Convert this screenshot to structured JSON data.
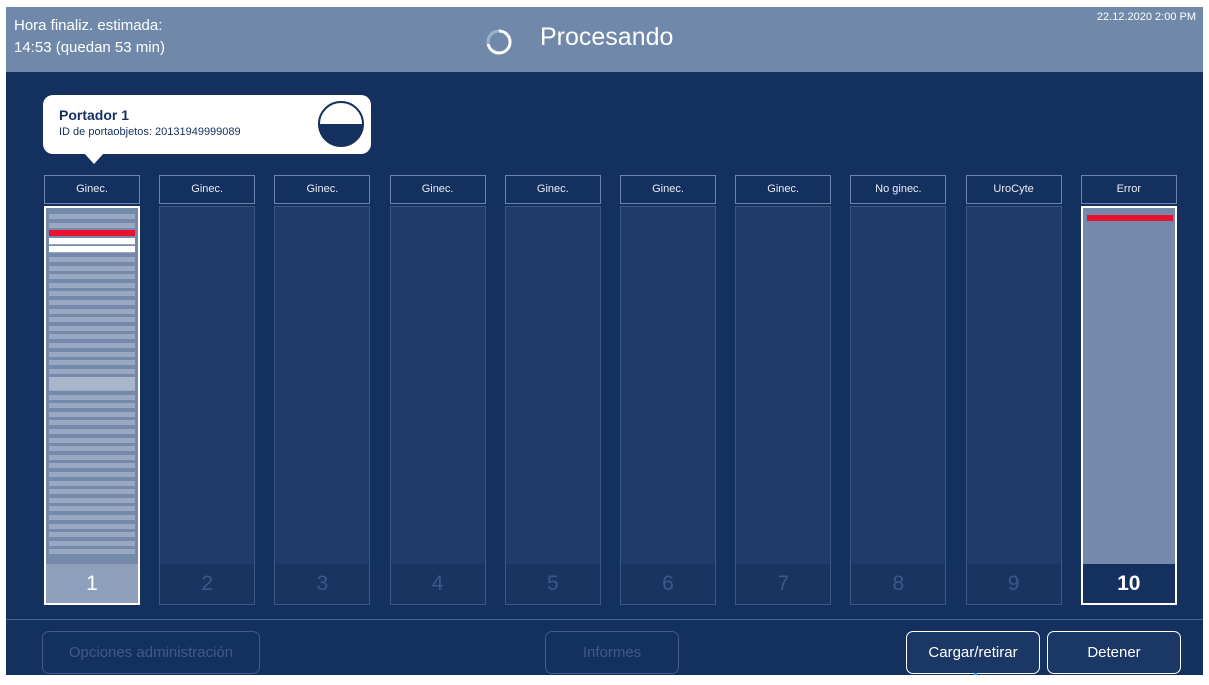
{
  "header": {
    "estimate_label": "Hora finaliz. estimada:",
    "estimate_value": "14:53 (quedan 53 min)",
    "status_title": "Procesando",
    "datetime": "22.12.2020 2:00 PM"
  },
  "popup": {
    "title": "Portador 1",
    "slide_id": "ID de portaobjetos: 20131949999089",
    "fill_level": 0.5
  },
  "carriers": [
    {
      "label": "Ginec.",
      "number": "1"
    },
    {
      "label": "Ginec.",
      "number": "2"
    },
    {
      "label": "Ginec.",
      "number": "3"
    },
    {
      "label": "Ginec.",
      "number": "4"
    },
    {
      "label": "Ginec.",
      "number": "5"
    },
    {
      "label": "Ginec.",
      "number": "6"
    },
    {
      "label": "Ginec.",
      "number": "7"
    },
    {
      "label": "No ginec.",
      "number": "8"
    },
    {
      "label": "UroCyte",
      "number": "9"
    },
    {
      "label": "Error",
      "number": "10"
    }
  ],
  "buttons": {
    "admin": "Opciones administración",
    "reports": "Informes",
    "load": "Cargar/retirar",
    "stop": "Detener"
  },
  "colors": {
    "background": "#14305f",
    "header": "#7089ab",
    "error": "#e8122f",
    "active": "#ffffff"
  }
}
